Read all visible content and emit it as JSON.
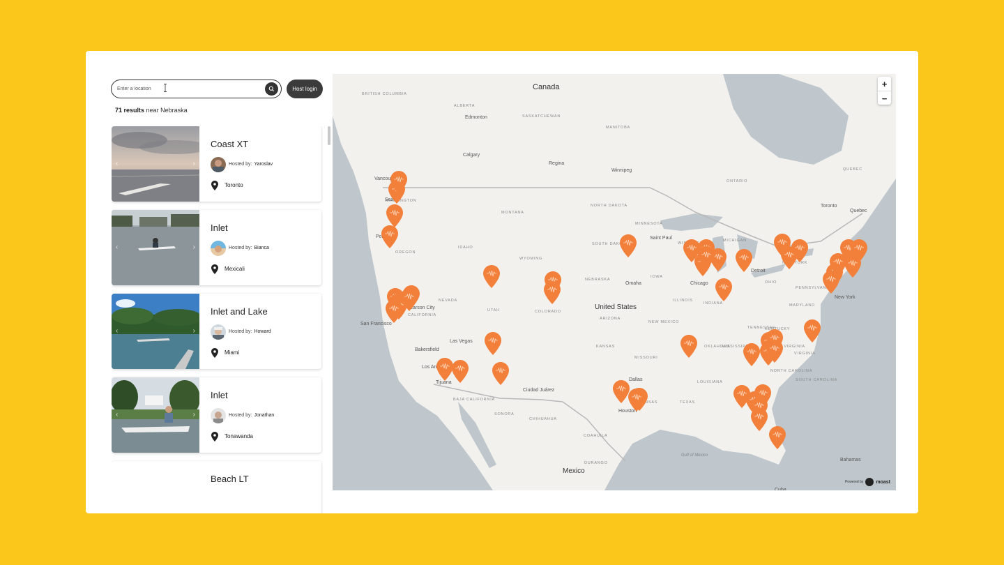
{
  "search": {
    "placeholder": "Enter a location"
  },
  "header": {
    "host_login": "Host login"
  },
  "results": {
    "count": "71 results",
    "near": "near",
    "location": "Nebraska"
  },
  "listings": [
    {
      "title": "Coast XT",
      "hosted_label": "Hosted by:",
      "host": "Yaroslav",
      "location": "Toronto"
    },
    {
      "title": "Inlet",
      "hosted_label": "Hosted by:",
      "host": "Bianca",
      "location": "Mexicali"
    },
    {
      "title": "Inlet and Lake",
      "hosted_label": "Hosted by:",
      "host": "Howard",
      "location": "Miami"
    },
    {
      "title": "Inlet",
      "hosted_label": "Hosted by:",
      "host": "Jonathan",
      "location": "Tonawanda"
    },
    {
      "title": "Beach LT"
    }
  ],
  "map": {
    "zoom_in": "+",
    "zoom_out": "−",
    "powered_by": "Powered by",
    "brand": "moast",
    "countries": [
      "Canada",
      "United States",
      "Mexico"
    ],
    "cities": [
      "Edmonton",
      "Calgary",
      "Regina",
      "Winnipeg",
      "Vancouver",
      "Seattle",
      "Portland",
      "Saint Paul",
      "Omaha",
      "Chicago",
      "Detroit",
      "Toronto",
      "New York",
      "Quebec",
      "Carson City",
      "San Francisco",
      "Las Vegas",
      "Los Angeles",
      "Tijuana",
      "Bakersfield",
      "Ciudad Juárez",
      "Dallas",
      "Houston",
      "Bahamas",
      "Cuba"
    ],
    "states": [
      "BRITISH COLUMBIA",
      "ALBERTA",
      "SASKATCHEWAN",
      "MANITOBA",
      "ONTARIO",
      "QUEBEC",
      "WASHINGTON",
      "OREGON",
      "IDAHO",
      "MONTANA",
      "WYOMING",
      "NORTH DAKOTA",
      "SOUTH DAKOTA",
      "NEBRASKA",
      "MINNESOTA",
      "IOWA",
      "WISCONSIN",
      "MICHIGAN",
      "ILLINOIS",
      "INDIANA",
      "OHIO",
      "PENNSYLVANIA",
      "NEW YORK",
      "NEVADA",
      "CALIFORNIA",
      "UTAH",
      "COLORADO",
      "ARIZONA",
      "NEW MEXICO",
      "KANSAS",
      "MISSOURI",
      "OKLAHOMA",
      "ARKANSAS",
      "TEXAS",
      "LOUISIANA",
      "MISSISSIPPI",
      "TENNESSEE",
      "KENTUCKY",
      "WEST VIRGINIA",
      "VIRGINIA",
      "NORTH CAROLINA",
      "SOUTH CAROLINA",
      "MARYLAND",
      "SONORA",
      "CHIHUAHUA",
      "COAHUILA",
      "BAJA CALIFORNIA",
      "DURANGO"
    ],
    "gulf": "Gulf of Mexico",
    "pin_color": "#F3803A",
    "pin_count": 56
  },
  "colors": {
    "background": "#FCC71B",
    "water": "#BFC7CC",
    "land": "#F2F1EE",
    "pin": "#F3803A"
  }
}
